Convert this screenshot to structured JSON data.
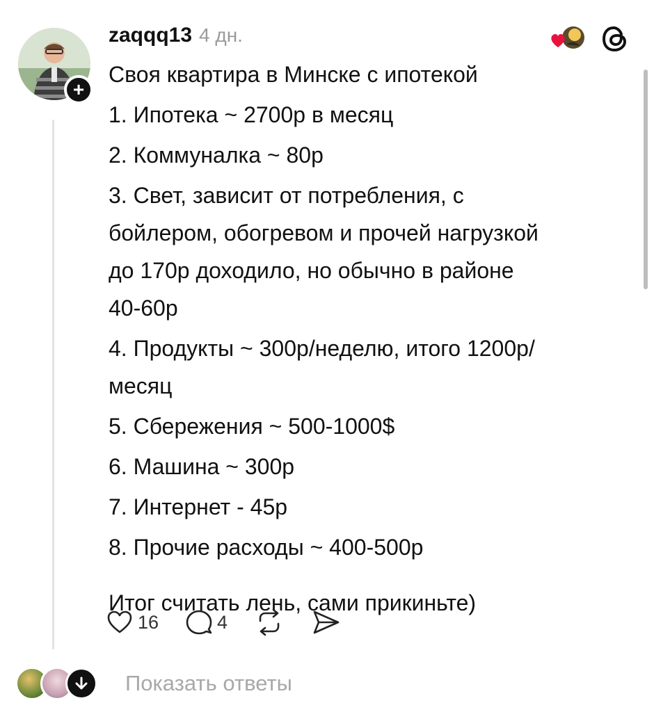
{
  "post": {
    "author": "zaqqq13",
    "timestamp": "4 дн.",
    "lines": {
      "title": "Своя квартира в Минске с ипотекой",
      "item1": "1. Ипотека ~ 2700р в месяц",
      "item2": "2. Коммуналка ~ 80р",
      "item3_l1": "3. Свет, зависит от потребления, с",
      "item3_l2": "бойлером, обогревом и прочей нагрузкой",
      "item3_l3": "до 170р доходило, но обычно в районе",
      "item3_l4": "40-60р",
      "item4_l1": "4. Продукты ~ 300р/неделю, итого 1200р/",
      "item4_l2": "месяц",
      "item5": "5. Сбережения ~ 500-1000$",
      "item6": "6. Машина ~ 300р",
      "item7": "7. Интернет - 45р",
      "item8": "8. Прочие расходы ~ 400-500р",
      "outro": "Итог считать лень, сами прикиньте)"
    }
  },
  "actions": {
    "likes": "16",
    "comments": "4"
  },
  "replies": {
    "show_label": "Показать ответы"
  },
  "icons": {
    "like": "heart-icon",
    "comment": "comment-bubble-icon",
    "repost": "repost-icon",
    "share": "send-icon",
    "threads": "threads-logo-icon",
    "follow": "plus-icon",
    "expand": "arrow-down-icon"
  },
  "colors": {
    "text": "#111111",
    "muted": "#9a9a9a",
    "reaction_heart": "#e8133d"
  }
}
